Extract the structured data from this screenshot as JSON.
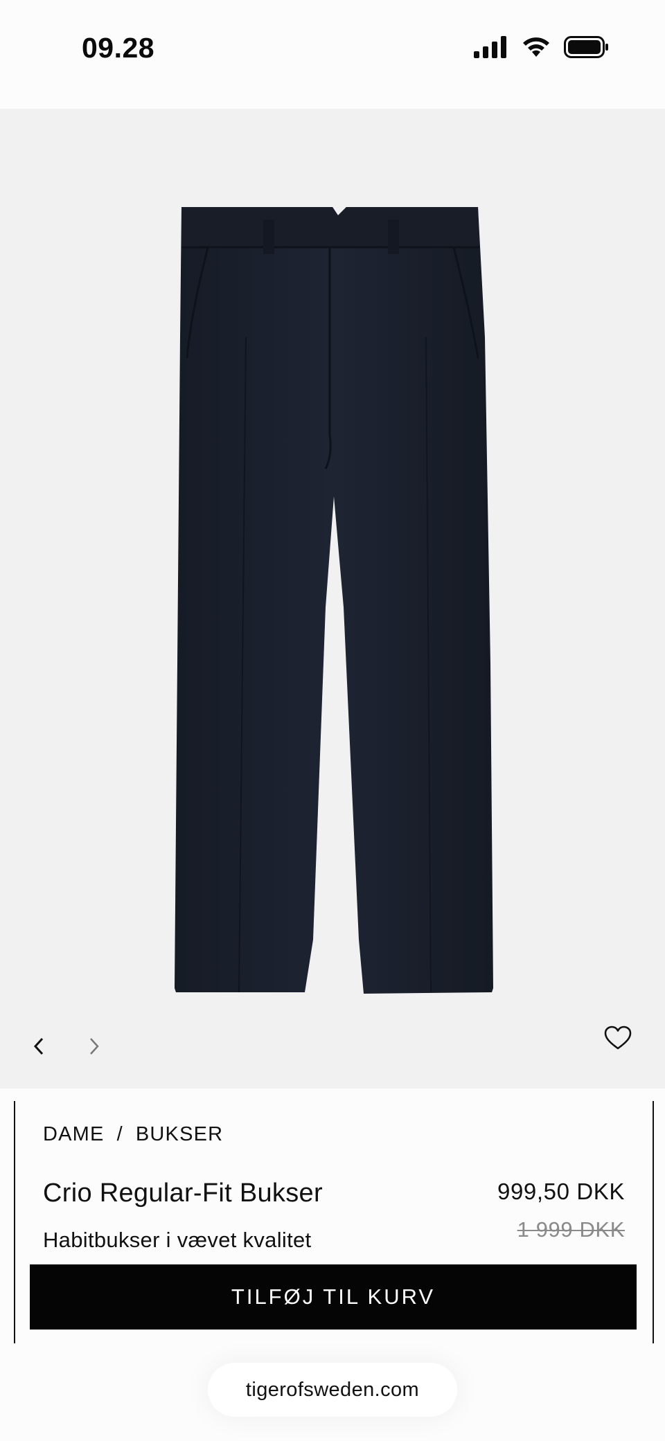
{
  "status": {
    "time": "09.28"
  },
  "gallery": {
    "image_alt": "Dark navy tailored trousers",
    "product_color": "#1d2330"
  },
  "product": {
    "breadcrumb": [
      "DAME",
      "/",
      "BUKSER"
    ],
    "title": "Crio Regular-Fit Bukser",
    "subtitle": "Habitbukser i vævet kvalitet",
    "price": "999,50 DKK",
    "original_price": "1 999 DKK",
    "cta_label": "TILFØJ TIL KURV"
  },
  "browser": {
    "url": "tigerofsweden.com"
  },
  "icons": {
    "prev": "chevron-left-icon",
    "next": "chevron-right-icon",
    "wishlist": "heart-icon",
    "signal": "cellular-signal-icon",
    "wifi": "wifi-icon",
    "battery": "battery-icon"
  }
}
